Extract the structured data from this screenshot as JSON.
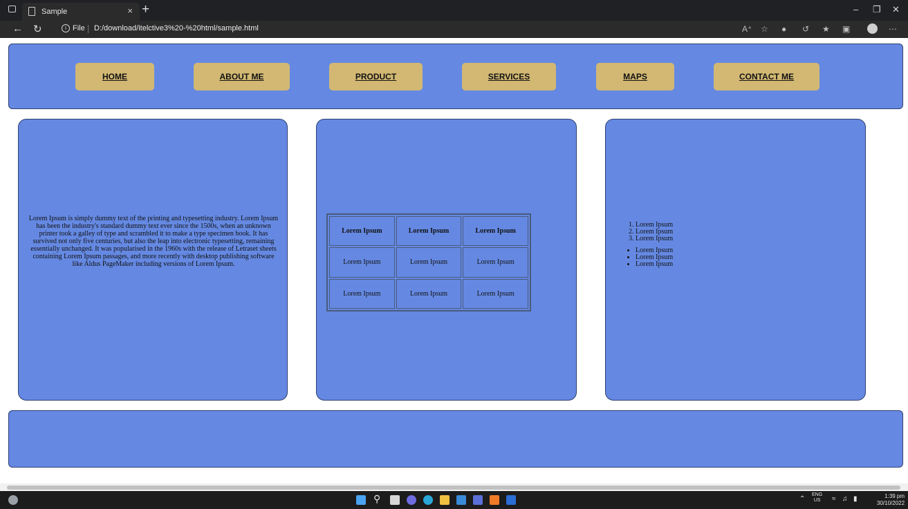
{
  "browser": {
    "tab_title": "Sample",
    "tab_close": "×",
    "new_tab": "+",
    "file_label": "File",
    "url": "D:/download/itelctive3%20-%20html/sample.html"
  },
  "nav": {
    "items": [
      "HOME",
      "ABOUT ME",
      "PRODUCT",
      "SERVICES",
      "MAPS",
      "CONTACT ME"
    ]
  },
  "left_panel": {
    "text": "Lorem Ipsum is simply dummy text of the printing and typesetting industry. Lorem Ipsum has been the industry's standard dummy text ever since the 1500s, when an unknown printer took a galley of type and scrambled it to make a type specimen book. It has survived not only five centuries, but also the leap into electronic typesetting, remaining essentially unchanged. It was popularised in the 1960s with the release of Letraset sheets containing Lorem Ipsum passages, and more recently with desktop publishing software like Aldus PageMaker including versions of Lorem Ipsum."
  },
  "table": {
    "headers": [
      "Lorem Ipsum",
      "Lorem Ipsum",
      "Lorem Ipsum"
    ],
    "rows": [
      [
        "Lorem Ipsum",
        "Lorem Ipsum",
        "Lorem Ipsum"
      ],
      [
        "Lorem Ipsum",
        "Lorem Ipsum",
        "Lorem Ipsum"
      ]
    ]
  },
  "right_panel": {
    "ordered": [
      "Lorem Ipsum",
      "Lorem Ipsum",
      "Lorem Ipsum"
    ],
    "unordered": [
      "Lorem Ipsum",
      "Lorem Ipsum",
      "Lorem Ipsum"
    ]
  },
  "taskbar": {
    "lang_top": "ENG",
    "lang_bottom": "US",
    "time": "1:39 pm",
    "date": "30/10/2022"
  },
  "colors": {
    "panel": "#6589e2",
    "nav_button": "#d2b873",
    "border": "#2d3f70"
  }
}
